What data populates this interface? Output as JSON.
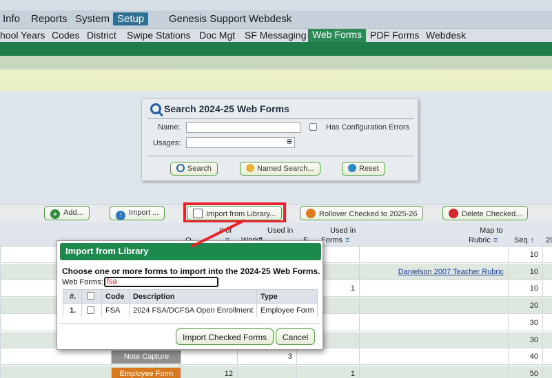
{
  "menu": {
    "items": [
      "Info",
      "Reports",
      "System",
      "Setup",
      "Genesis Support",
      "Webdesk"
    ],
    "selected": "Setup"
  },
  "tabs": {
    "items": [
      "hool Years",
      "Codes",
      "District",
      "Swipe Stations",
      "Doc Mgt",
      "SF Messaging",
      "Web Forms",
      "PDF Forms",
      "Webdesk"
    ],
    "selected": "Web Forms"
  },
  "search": {
    "title": "Search 2024-25 Web Forms",
    "name_label": "Name:",
    "usages_label": "Usages:",
    "config_errors_label": "Has Configuration Errors",
    "search_button": "Search",
    "named_search_button": "Named Search...",
    "reset_button": "Reset"
  },
  "actions": {
    "add": "Add...",
    "import": "Import ...",
    "import_library": "Import from Library...",
    "rollover": "Rollover Checked to 2025-26",
    "delete": "Delete Checked..."
  },
  "table": {
    "headers": {
      "of_line1": "# of",
      "used_in_1": "Used in",
      "used_in_2": "Used in",
      "forms": "Forms",
      "map_to": "Map to",
      "rubric": "Rubric",
      "seq": "Seq",
      "seq_sort": "↑",
      "last_col": "20",
      "partial_a": "U",
      "partial_b": "Q",
      "partial_c": "Workfl",
      "partial_d": "F"
    },
    "rows": [
      {
        "usage": "",
        "count": "",
        "workflow": "",
        "forms": "",
        "rubric": "",
        "seq": "10"
      },
      {
        "usage": "",
        "count": "",
        "workflow": "",
        "forms": "",
        "rubric": "Danielson 2007 Teacher Rubric",
        "seq": "10"
      },
      {
        "usage": "",
        "count": "",
        "workflow": "",
        "forms": "1",
        "rubric": "",
        "seq": "10"
      },
      {
        "usage": "",
        "count": "",
        "workflow": "",
        "forms": "",
        "rubric": "",
        "seq": "20"
      },
      {
        "usage": "",
        "count": "",
        "workflow": "",
        "forms": "",
        "rubric": "",
        "seq": "30"
      },
      {
        "usage": "",
        "count": "",
        "workflow": "",
        "forms": "",
        "rubric": "",
        "seq": "30"
      },
      {
        "usage": "Note Capture",
        "count": "",
        "workflow": "3",
        "forms": "",
        "rubric": "",
        "seq": "40"
      },
      {
        "usage": "Employee Form",
        "count": "12",
        "workflow": "",
        "forms": "1",
        "rubric": "",
        "seq": "50"
      }
    ]
  },
  "modal": {
    "title": "Import from Library",
    "intro": "Choose one or more forms to import into the 2024-25 Web Forms.",
    "filter_label": "Web Forms:",
    "filter_value": "fsa",
    "columns": {
      "num": "#.",
      "code": "Code",
      "description": "Description",
      "type": "Type"
    },
    "rows": [
      {
        "num": "1.",
        "code": "FSA",
        "description": "2024 FSA/DCFSA Open Enrollment",
        "type": "Employee Form"
      }
    ],
    "import_button": "Import Checked Forms",
    "cancel_button": "Cancel"
  },
  "colors": {
    "accent_green": "#1b8a4c",
    "highlight_red": "#e8232b",
    "note_capture_chip": "#8f8f8f",
    "employee_form_chip": "#d9791f",
    "link": "#1a3da8"
  }
}
